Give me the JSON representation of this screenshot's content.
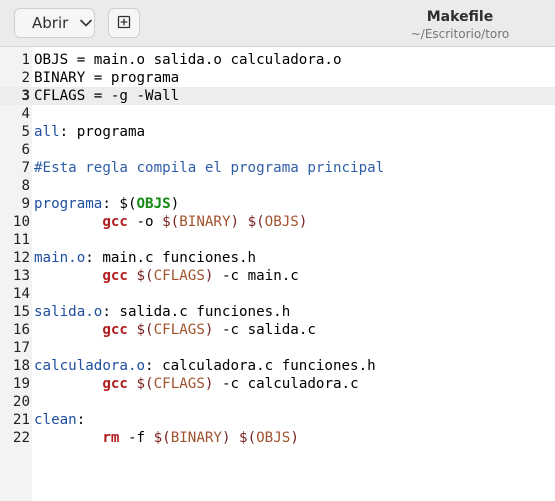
{
  "header": {
    "open_label": "Abrir",
    "title": "Makefile",
    "subtitle": "~/Escritorio/toro"
  },
  "icons": {
    "open_dropdown": "chevron-down-icon",
    "new_document": "new-document-icon"
  },
  "colors": {
    "variable": "#1f4fa0",
    "variable_ref": "#138a13",
    "command": "#b11d1d",
    "macro": "#a0522d",
    "comment": "#2f5ea8",
    "current_line": "#ededed"
  },
  "editor": {
    "current_line": 3,
    "lines": [
      {
        "n": "1",
        "segments": [
          {
            "t": "OBJS = main.o salida.o calculadora.o",
            "c": ""
          }
        ]
      },
      {
        "n": "2",
        "segments": [
          {
            "t": "BINARY = programa",
            "c": ""
          }
        ]
      },
      {
        "n": "3",
        "segments": [
          {
            "t": "CFLAGS = -g -Wall",
            "c": ""
          }
        ]
      },
      {
        "n": "4",
        "segments": []
      },
      {
        "n": "5",
        "segments": [
          {
            "t": "all",
            "c": "var"
          },
          {
            "t": ": programa",
            "c": ""
          }
        ]
      },
      {
        "n": "6",
        "segments": []
      },
      {
        "n": "7",
        "segments": [
          {
            "t": "#Esta regla compila el programa principal",
            "c": "comment"
          }
        ]
      },
      {
        "n": "8",
        "segments": []
      },
      {
        "n": "9",
        "segments": [
          {
            "t": "programa",
            "c": "var"
          },
          {
            "t": ": $(",
            "c": ""
          },
          {
            "t": "OBJS",
            "c": "varb"
          },
          {
            "t": ")",
            "c": ""
          }
        ]
      },
      {
        "n": "10",
        "segments": [
          {
            "t": "        ",
            "c": ""
          },
          {
            "t": "gcc",
            "c": "cmd"
          },
          {
            "t": " -o ",
            "c": ""
          },
          {
            "t": "$(",
            "c": "macro"
          },
          {
            "t": "BINARY",
            "c": "mname"
          },
          {
            "t": ")",
            "c": "macro"
          },
          {
            "t": " ",
            "c": ""
          },
          {
            "t": "$(",
            "c": "macro"
          },
          {
            "t": "OBJS",
            "c": "mname"
          },
          {
            "t": ")",
            "c": "macro"
          }
        ]
      },
      {
        "n": "11",
        "segments": []
      },
      {
        "n": "12",
        "segments": [
          {
            "t": "main.o",
            "c": "var"
          },
          {
            "t": ": main.c funciones.h",
            "c": ""
          }
        ]
      },
      {
        "n": "13",
        "segments": [
          {
            "t": "        ",
            "c": ""
          },
          {
            "t": "gcc",
            "c": "cmd"
          },
          {
            "t": " ",
            "c": ""
          },
          {
            "t": "$(",
            "c": "macro"
          },
          {
            "t": "CFLAGS",
            "c": "mname"
          },
          {
            "t": ")",
            "c": "macro"
          },
          {
            "t": " -c main.c",
            "c": ""
          }
        ]
      },
      {
        "n": "14",
        "segments": []
      },
      {
        "n": "15",
        "segments": [
          {
            "t": "salida.o",
            "c": "var"
          },
          {
            "t": ": salida.c funciones.h",
            "c": ""
          }
        ]
      },
      {
        "n": "16",
        "segments": [
          {
            "t": "        ",
            "c": ""
          },
          {
            "t": "gcc",
            "c": "cmd"
          },
          {
            "t": " ",
            "c": ""
          },
          {
            "t": "$(",
            "c": "macro"
          },
          {
            "t": "CFLAGS",
            "c": "mname"
          },
          {
            "t": ")",
            "c": "macro"
          },
          {
            "t": " -c salida.c",
            "c": ""
          }
        ]
      },
      {
        "n": "17",
        "segments": []
      },
      {
        "n": "18",
        "segments": [
          {
            "t": "calculadora.o",
            "c": "var"
          },
          {
            "t": ": calculadora.c funciones.h",
            "c": ""
          }
        ]
      },
      {
        "n": "19",
        "segments": [
          {
            "t": "        ",
            "c": ""
          },
          {
            "t": "gcc",
            "c": "cmd"
          },
          {
            "t": " ",
            "c": ""
          },
          {
            "t": "$(",
            "c": "macro"
          },
          {
            "t": "CFLAGS",
            "c": "mname"
          },
          {
            "t": ")",
            "c": "macro"
          },
          {
            "t": " -c calculadora.c",
            "c": ""
          }
        ]
      },
      {
        "n": "20",
        "segments": []
      },
      {
        "n": "21",
        "segments": [
          {
            "t": "clean",
            "c": "var"
          },
          {
            "t": ":",
            "c": ""
          }
        ]
      },
      {
        "n": "22",
        "segments": [
          {
            "t": "        ",
            "c": ""
          },
          {
            "t": "rm",
            "c": "cmd"
          },
          {
            "t": " -f ",
            "c": ""
          },
          {
            "t": "$(",
            "c": "macro"
          },
          {
            "t": "BINARY",
            "c": "mname"
          },
          {
            "t": ")",
            "c": "macro"
          },
          {
            "t": " ",
            "c": ""
          },
          {
            "t": "$(",
            "c": "macro"
          },
          {
            "t": "OBJS",
            "c": "mname"
          },
          {
            "t": ")",
            "c": "macro"
          }
        ]
      }
    ]
  }
}
